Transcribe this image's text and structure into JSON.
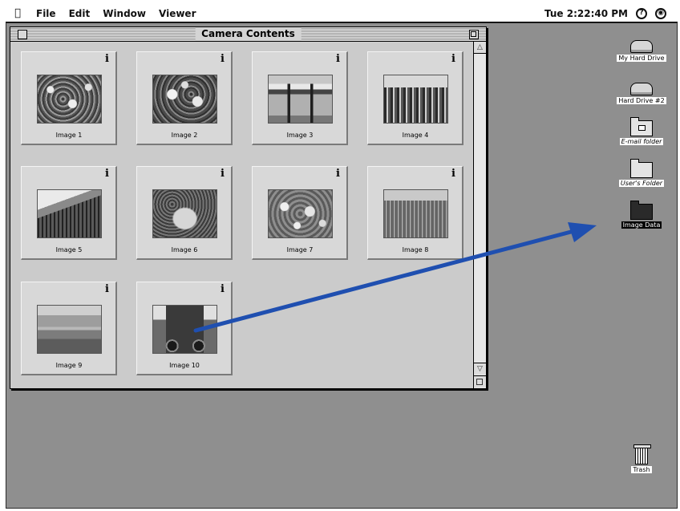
{
  "menubar": {
    "apple_icon": "apple-icon",
    "items": [
      "File",
      "Edit",
      "Window",
      "Viewer"
    ],
    "clock": "Tue 2:22:40 PM",
    "help_icon": "?",
    "app_icon": "camera-icon"
  },
  "window": {
    "title": "Camera Contents",
    "thumbnails": [
      {
        "label": "Image 1",
        "info": "i"
      },
      {
        "label": "Image 2",
        "info": "i"
      },
      {
        "label": "Image 3",
        "info": "i"
      },
      {
        "label": "Image 4",
        "info": "i"
      },
      {
        "label": "Image 5",
        "info": "i"
      },
      {
        "label": "Image 6",
        "info": "i"
      },
      {
        "label": "Image 7",
        "info": "i"
      },
      {
        "label": "Image 8",
        "info": "i"
      },
      {
        "label": "Image 9",
        "info": "i"
      },
      {
        "label": "Image 10",
        "info": "i"
      }
    ]
  },
  "desktop": {
    "icons": [
      {
        "label": "My Hard Drive"
      },
      {
        "label": "Hard Drive #2"
      },
      {
        "label": "E-mail folder"
      },
      {
        "label": "User's Folder"
      },
      {
        "label": "Image Data"
      },
      {
        "label": "Trash"
      }
    ]
  },
  "colors": {
    "desktop": "#8f8f8f",
    "window": "#cfcfcf",
    "arrow": "#1f4fb0"
  }
}
